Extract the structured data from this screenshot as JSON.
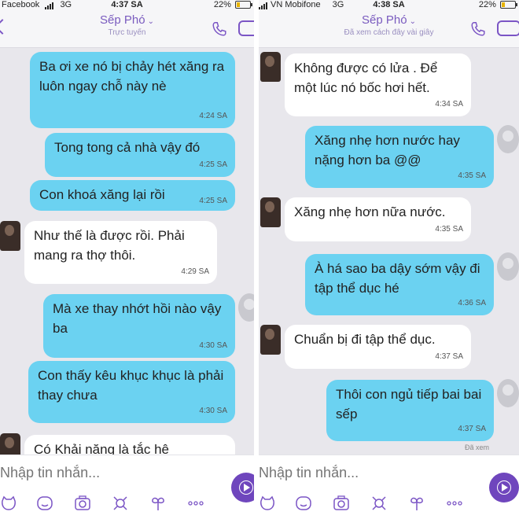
{
  "left": {
    "status": {
      "carrier": "Facebook",
      "network": "3G",
      "time": "4:37 SA",
      "battery": "22%",
      "battery_level": 0.22
    },
    "contact": {
      "name": "Sếp Phó",
      "sub": "Trực tuyến"
    },
    "messages": [
      {
        "dir": "out",
        "text": "Ba ơi xe nó bị chảy hét xăng ra luôn ngay chỗ này nè",
        "time": "4:24 SA"
      },
      {
        "dir": "out",
        "text": "Tong tong cả nhà vậy đó",
        "time": "4:25 SA"
      },
      {
        "dir": "out",
        "text": "Con khoá xăng lại rồi",
        "time": "4:25 SA"
      },
      {
        "dir": "in",
        "text": "Như thế là được rồi. Phải mang ra thợ thôi.",
        "time": "4:29 SA"
      },
      {
        "dir": "out",
        "text": "Mà xe thay nhớt hồi nào vậy ba",
        "time": "4:30 SA"
      },
      {
        "dir": "out",
        "text": "Con thấy kêu khục khục là phải thay chưa",
        "time": "4:30 SA"
      },
      {
        "dir": "in",
        "text": "Có Khải năng là tắc hệ",
        "time": ""
      }
    ],
    "composer": {
      "placeholder": "Nhập tin nhắn..."
    }
  },
  "right": {
    "status": {
      "carrier": "VN Mobifone",
      "network": "3G",
      "time": "4:38 SA",
      "battery": "22%",
      "battery_level": 0.22
    },
    "contact": {
      "name": "Sếp Phó",
      "sub": "Đã xem cách đây vài giây"
    },
    "messages": [
      {
        "dir": "in",
        "text": "Không được có lửa . Để một lúc nó bốc hơi hết.",
        "time": "4:34 SA"
      },
      {
        "dir": "out",
        "text": "Xăng nhẹ hơn nước hay nặng hơn ba @@",
        "time": "4:35 SA"
      },
      {
        "dir": "in",
        "text": "Xăng nhẹ hơn nữa nước.",
        "time": "4:35 SA"
      },
      {
        "dir": "out",
        "text": "À há sao ba dậy sớm vậy đi tập thể dục hé",
        "time": "4:36 SA"
      },
      {
        "dir": "in",
        "text": "Chuẩn bị đi tập thể dục.",
        "time": "4:37 SA"
      },
      {
        "dir": "out",
        "text": "Thôi con ngủ tiếp bai bai sếp",
        "time": "4:37 SA"
      }
    ],
    "seen_label": "Đã xem",
    "composer": {
      "placeholder": "Nhập tin nhắn..."
    }
  },
  "icons": {
    "toolbar": [
      "sticker-icon",
      "emoji-icon",
      "camera-icon",
      "doodle-icon",
      "gif-icon",
      "more-icon"
    ],
    "header": [
      "back-icon",
      "phone-icon",
      "video-call-icon"
    ],
    "send": "send-icon"
  },
  "colors": {
    "accent": "#7b55c5",
    "outgoing_bubble": "#6bd2f1",
    "incoming_bubble": "#ffffff",
    "background": "#e8e7ec"
  }
}
